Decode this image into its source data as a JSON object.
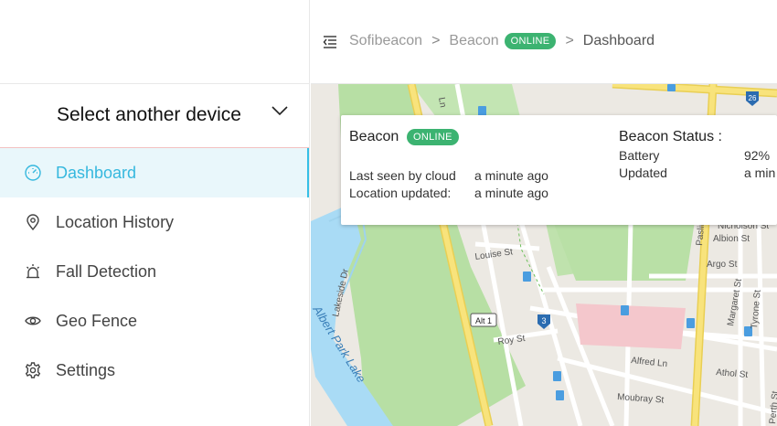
{
  "sidebar": {
    "device_select_label": "Select another device",
    "items": [
      {
        "label": "Dashboard",
        "icon": "gauge-icon",
        "active": true
      },
      {
        "label": "Location History",
        "icon": "location-pin-icon",
        "active": false
      },
      {
        "label": "Fall Detection",
        "icon": "alarm-light-icon",
        "active": false
      },
      {
        "label": "Geo Fence",
        "icon": "eye-icon",
        "active": false
      },
      {
        "label": "Settings",
        "icon": "gear-icon",
        "active": false
      }
    ]
  },
  "header": {
    "breadcrumb": {
      "root": "Sofibeacon",
      "separator": ">",
      "device": "Beacon",
      "device_status": "ONLINE",
      "current": "Dashboard"
    }
  },
  "card": {
    "device_name": "Beacon",
    "device_status": "ONLINE",
    "last_seen_label": "Last seen by cloud",
    "last_seen_value": "a minute ago",
    "location_updated_label": "Location updated:",
    "location_updated_value": "a minute ago",
    "status_title": "Beacon Status :",
    "battery_label": "Battery",
    "battery_value": "92%",
    "updated_label": "Updated",
    "updated_value": "a min"
  },
  "map": {
    "labels": {
      "ln": "Ln",
      "lakeside": "Lakeside Dr",
      "albert_park_lake": "Albert Park Lake",
      "louise": "Louise St",
      "roy": "Roy St",
      "alt1": "Alt 1",
      "route3": "3",
      "route26": "26",
      "albion": "Albion St",
      "argo": "Argo St",
      "alfred": "Alfred Ln",
      "moubray": "Moubray St",
      "athol": "Athol St",
      "margaret": "Margaret St",
      "tyrone": "Tyrone St",
      "perth": "Perth St",
      "nicholson": "Nicholson St",
      "paslin": "Paslin"
    }
  },
  "colors": {
    "accent": "#36b8de",
    "active_bg": "#e9f7fb",
    "online_badge": "#3cb371",
    "park": "#b7dfa4",
    "water": "#a9dbf5",
    "road_major": "#f6e07a",
    "hospital": "#f4c7cc"
  }
}
